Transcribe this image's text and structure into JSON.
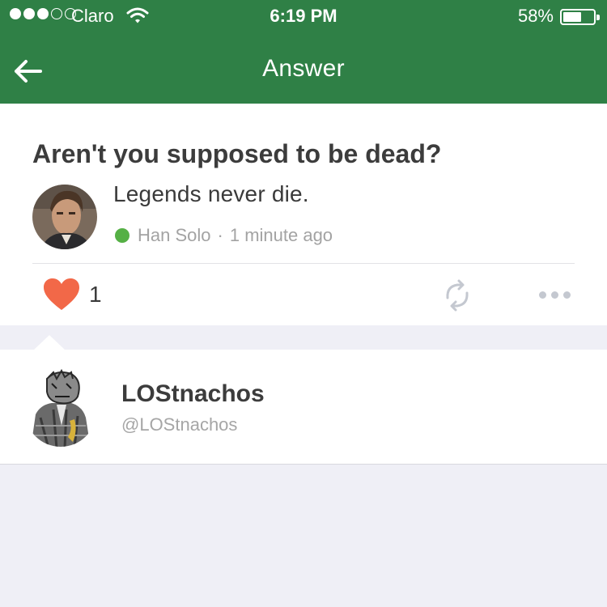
{
  "status_bar": {
    "carrier": "Claro",
    "time": "6:19 PM",
    "battery_percent": "58%",
    "signal_bars_filled": 3,
    "signal_bars_total": 5,
    "battery_level": 0.58
  },
  "nav": {
    "title": "Answer",
    "back_icon": "arrow-left-icon"
  },
  "answer": {
    "question": "Aren't you supposed to be dead?",
    "text": "Legends never die.",
    "author": "Han Solo",
    "separator": "·",
    "time_ago": "1 minute ago",
    "like_count": "1",
    "icons": [
      "heart-icon",
      "repost-icon",
      "more-dots-icon"
    ]
  },
  "user": {
    "name": "LOStnachos",
    "handle": "@LOStnachos"
  },
  "colors": {
    "header": "#2f8046",
    "like": "#f26848",
    "online": "#55b045",
    "background": "#efeff6"
  }
}
